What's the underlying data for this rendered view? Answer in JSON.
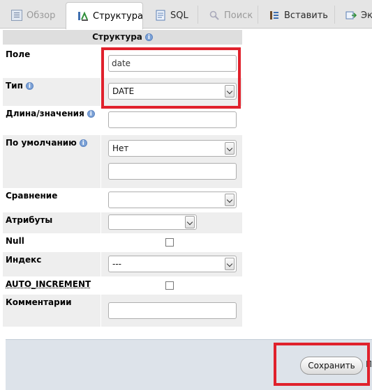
{
  "tabs": [
    {
      "label": "Обзор",
      "icon": "table-icon",
      "state": "disabled"
    },
    {
      "label": "Структура",
      "icon": "structure-icon",
      "state": "active"
    },
    {
      "label": "SQL",
      "icon": "sql-icon",
      "state": "normal"
    },
    {
      "label": "Поиск",
      "icon": "search-icon",
      "state": "disabled"
    },
    {
      "label": "Вставить",
      "icon": "insert-icon",
      "state": "normal"
    },
    {
      "label": "Эк",
      "icon": "export-icon",
      "state": "normal"
    }
  ],
  "form": {
    "header": "Структура",
    "field": {
      "label": "Поле",
      "value": "date"
    },
    "type": {
      "label": "Тип",
      "value": "DATE"
    },
    "length": {
      "label": "Длина/значения",
      "value": ""
    },
    "default": {
      "label": "По умолчанию",
      "value": "Нет",
      "extra_value": ""
    },
    "collation": {
      "label": "Сравнение",
      "value": ""
    },
    "attributes": {
      "label": "Атрибуты",
      "value": ""
    },
    "null": {
      "label": "Null",
      "checked": false
    },
    "index": {
      "label": "Индекс",
      "value": "---"
    },
    "auto_increment": {
      "label": "AUTO_INCREMENT",
      "checked": false
    },
    "comments": {
      "label": "Комментарии",
      "value": ""
    }
  },
  "footer": {
    "save_label": "Сохранить",
    "clipped_text": "П"
  },
  "colors": {
    "highlight": "#e0212c",
    "header_bg": "#dedede",
    "row_gray": "#eeeeee",
    "footer_bg": "#dde3ea"
  }
}
